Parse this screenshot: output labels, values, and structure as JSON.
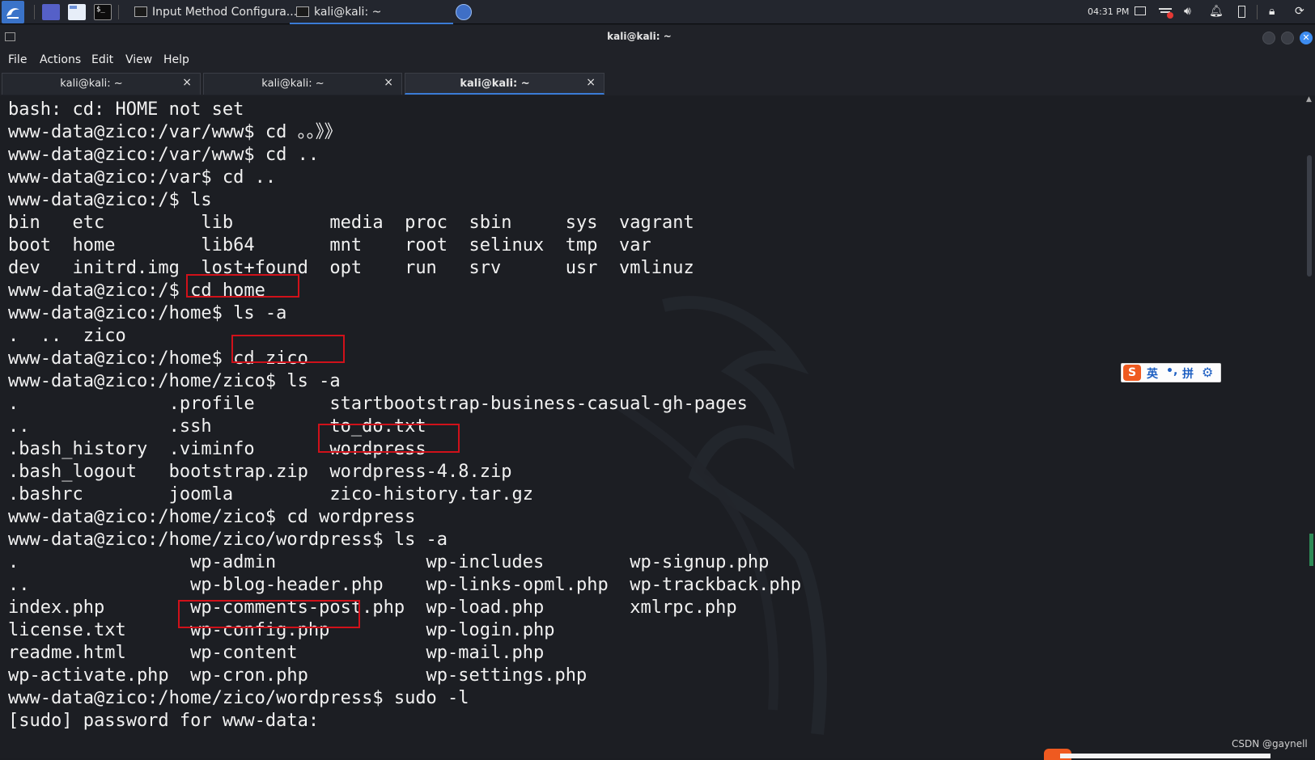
{
  "taskbar": {
    "tasks": [
      {
        "label": "Input Method Configura..."
      },
      {
        "label": "kali@kali: ~"
      }
    ],
    "clock": "04:31 PM"
  },
  "window": {
    "title": "kali@kali: ~",
    "menu": [
      "File",
      "Actions",
      "Edit",
      "View",
      "Help"
    ],
    "tabs": [
      {
        "label": "kali@kali: ~",
        "active": false
      },
      {
        "label": "kali@kali: ~",
        "active": false
      },
      {
        "label": "kali@kali: ~",
        "active": true
      }
    ],
    "tab_close_glyph": "×"
  },
  "terminal": {
    "lines": [
      "bash: cd: HOME not set",
      "www-data@zico:/var/www$ cd 。。》》",
      "www-data@zico:/var/www$ cd ..",
      "www-data@zico:/var$ cd ..",
      "www-data@zico:/$ ls",
      "bin   etc         lib         media  proc  sbin     sys  vagrant",
      "boot  home        lib64       mnt    root  selinux  tmp  var",
      "dev   initrd.img  lost+found  opt    run   srv      usr  vmlinuz",
      "www-data@zico:/$ cd home",
      "www-data@zico:/home$ ls -a",
      ".  ..  zico",
      "www-data@zico:/home$ cd zico",
      "www-data@zico:/home/zico$ ls -a",
      ".              .profile       startbootstrap-business-casual-gh-pages",
      "..             .ssh           to_do.txt",
      ".bash_history  .viminfo       wordpress",
      ".bash_logout   bootstrap.zip  wordpress-4.8.zip",
      ".bashrc        joomla         zico-history.tar.gz",
      "www-data@zico:/home/zico$ cd wordpress",
      "www-data@zico:/home/zico/wordpress$ ls -a",
      ".                wp-admin              wp-includes        wp-signup.php",
      "..               wp-blog-header.php    wp-links-opml.php  wp-trackback.php",
      "index.php        wp-comments-post.php  wp-load.php        xmlrpc.php",
      "license.txt      wp-config.php         wp-login.php",
      "readme.html      wp-content            wp-mail.php",
      "wp-activate.php  wp-cron.php           wp-settings.php",
      "www-data@zico:/home/zico/wordpress$ sudo -l",
      "[sudo] password for www-data: "
    ],
    "highlight_color": "#d0111a"
  },
  "ime": {
    "logo": "S",
    "lang": "英",
    "punct": "•,",
    "mode": "拼",
    "settings_icon": "gear-icon"
  },
  "watermark": "CSDN @gaynell",
  "colors": {
    "terminal_bg": "#1c1e23",
    "accent": "#3a7bd5",
    "ime_orange": "#ef5a20"
  }
}
